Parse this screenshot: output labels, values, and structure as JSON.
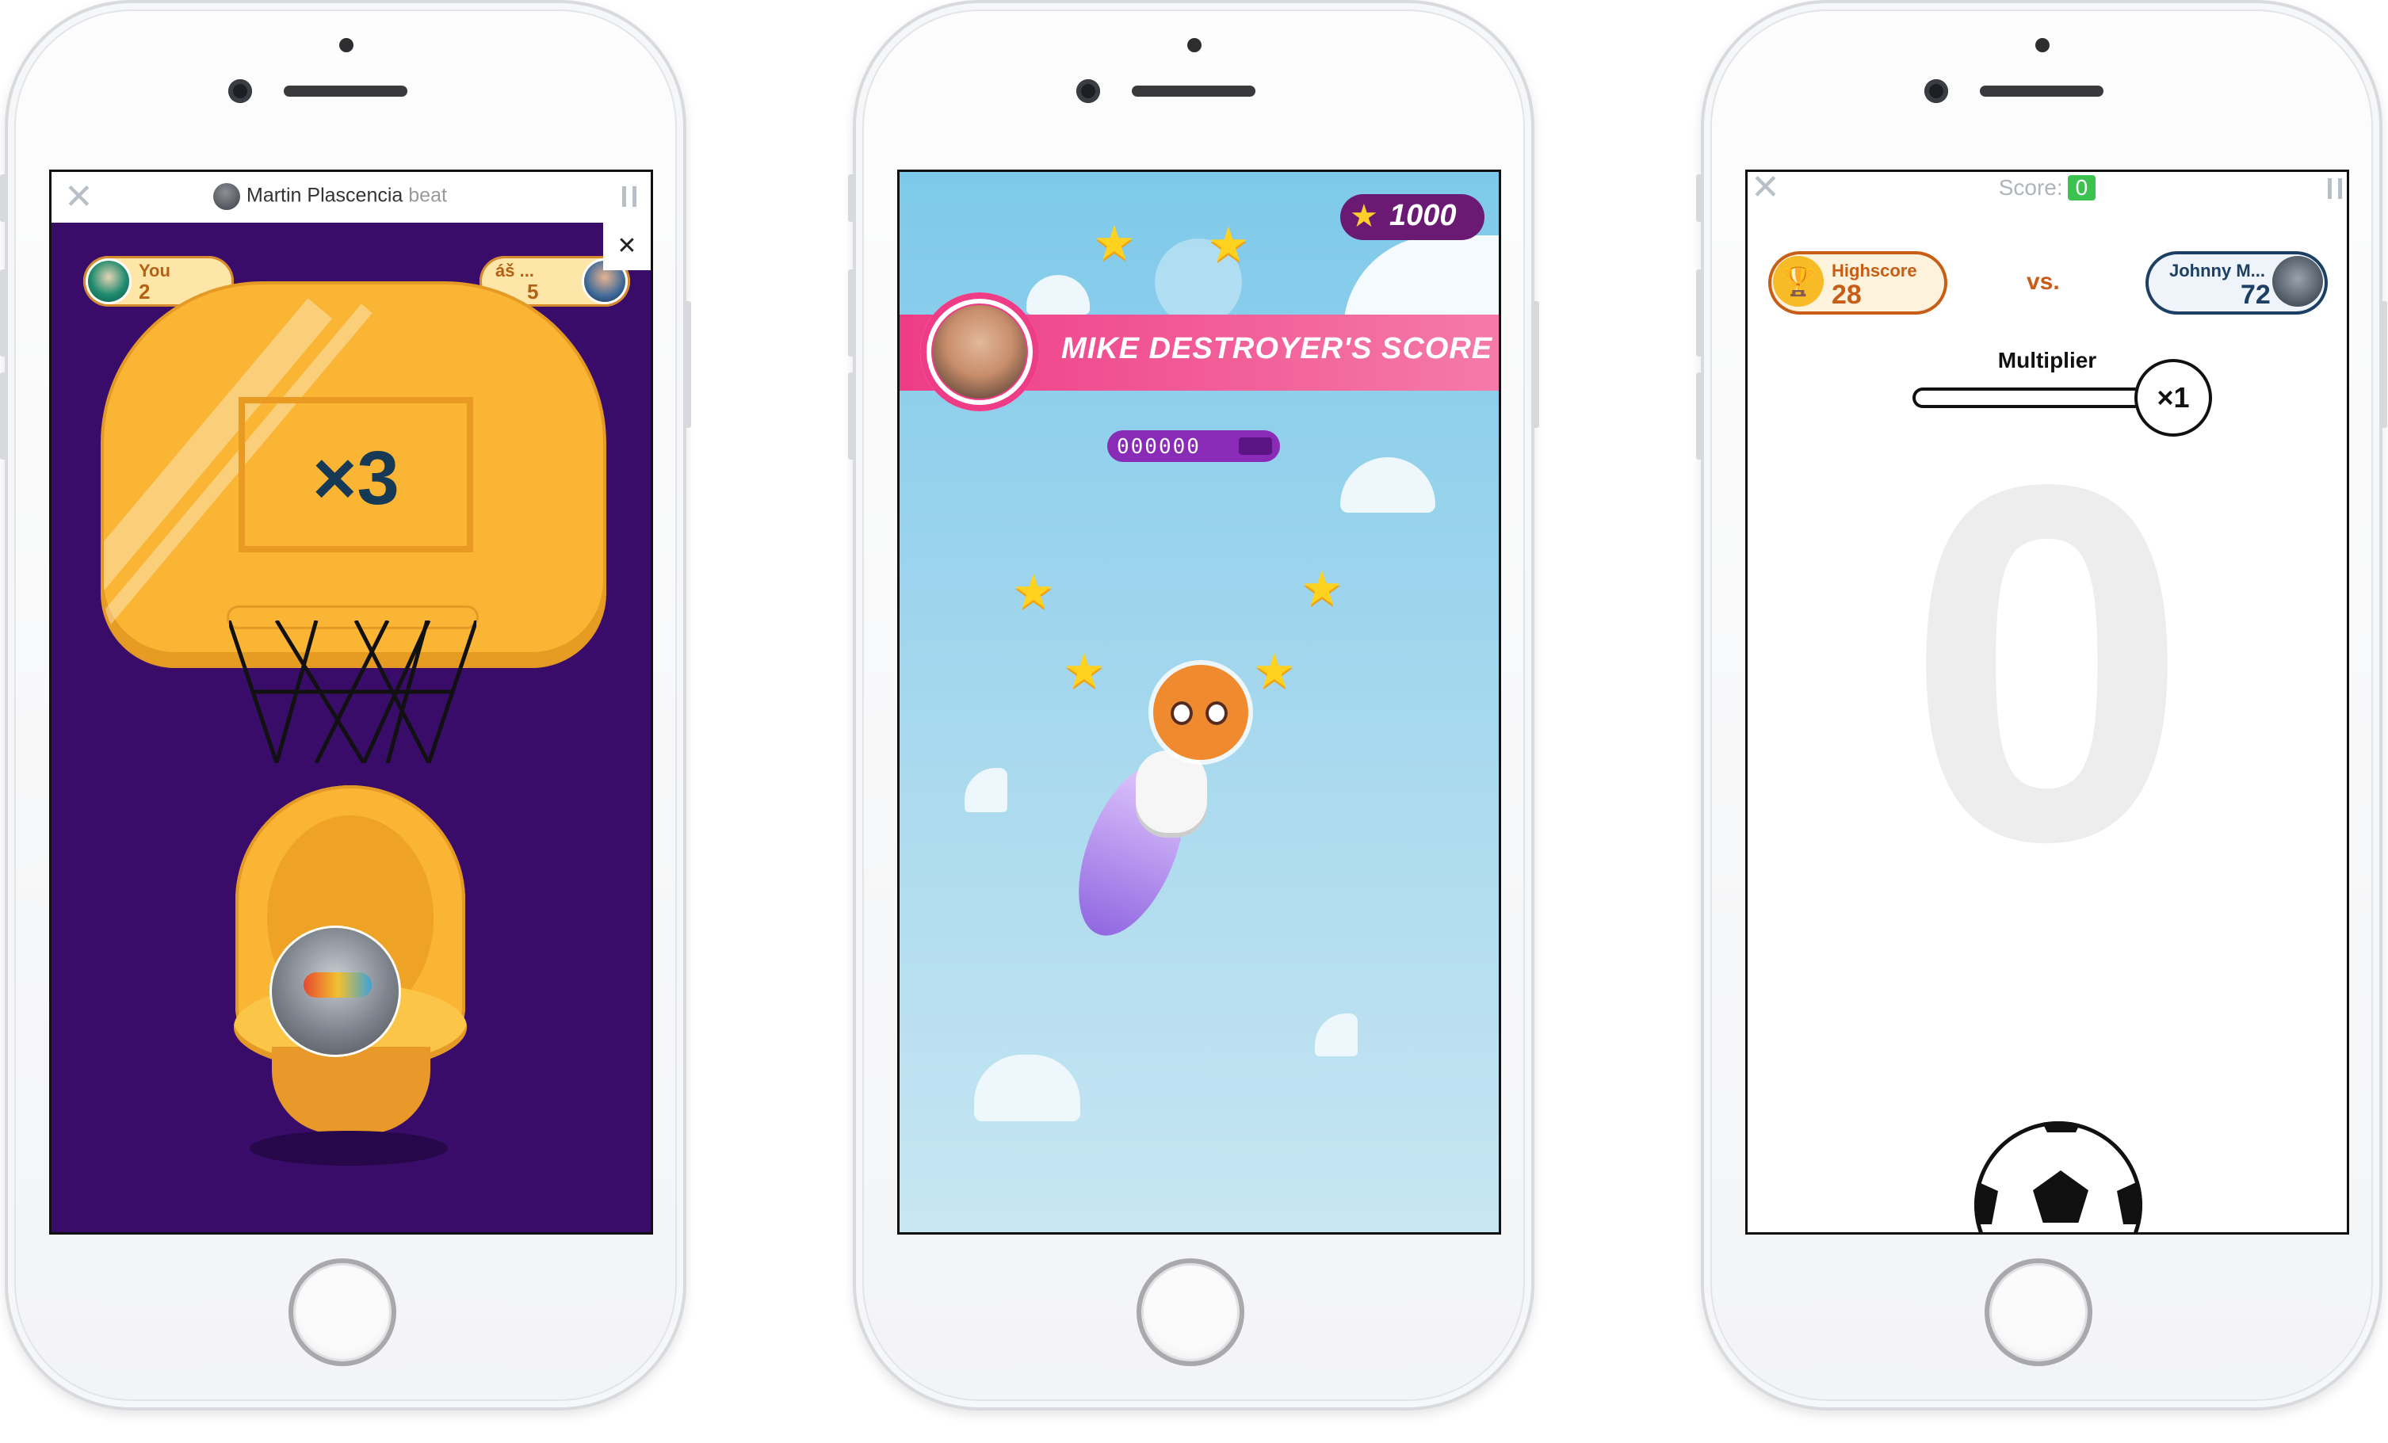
{
  "phone1": {
    "header": {
      "name": "Martin Plascencia",
      "suffix": "beat"
    },
    "player_you": {
      "label": "You",
      "score": "2"
    },
    "player_opponent": {
      "label": "áš ...",
      "score": "5"
    },
    "multiplier": "×3"
  },
  "phone2": {
    "coins": "1000",
    "banner": "MIKE DESTROYER'S SCORE",
    "progress": "000000",
    "progress_fill_fraction": 0.6
  },
  "phone3": {
    "score_label": "Score:",
    "score_value": "0",
    "highscore": {
      "label": "Highscore",
      "value": "28"
    },
    "vs": "vs.",
    "opponent": {
      "label": "Johnny M...",
      "value": "72"
    },
    "multiplier_label": "Multiplier",
    "multiplier_value": "×1",
    "big_score": "0"
  },
  "colors": {
    "purple_bg": "#3a0c69",
    "board_orange": "#f9b533",
    "pink_banner": "#ee3c86",
    "green_score": "#3cc34f"
  }
}
